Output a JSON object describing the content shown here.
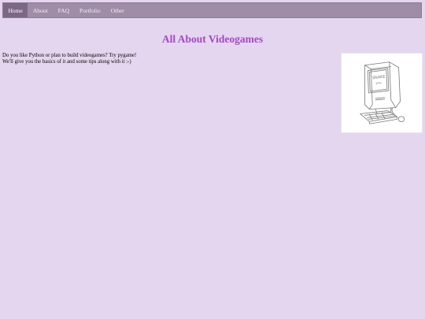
{
  "nav": {
    "items": [
      {
        "label": "Home",
        "active": true
      },
      {
        "label": "About",
        "active": false
      },
      {
        "label": "FAQ",
        "active": false
      },
      {
        "label": "Portfolio",
        "active": false
      },
      {
        "label": "Other",
        "active": false
      }
    ]
  },
  "page": {
    "title": "All About Videogames",
    "intro_lines": [
      "Do you like Python or plan to build videogames? Try pygame!",
      "We'll give you the basics of it and some tips along with it :-)"
    ],
    "illustration": {
      "icon": "retro-computer-sketch-icon",
      "screen_text": [
        "SNAKE",
        "10%"
      ]
    }
  },
  "colors": {
    "background": "#e3d6ee",
    "nav_bar": "#9f8ca6",
    "nav_active": "#7c6786",
    "title": "#a646c8"
  }
}
